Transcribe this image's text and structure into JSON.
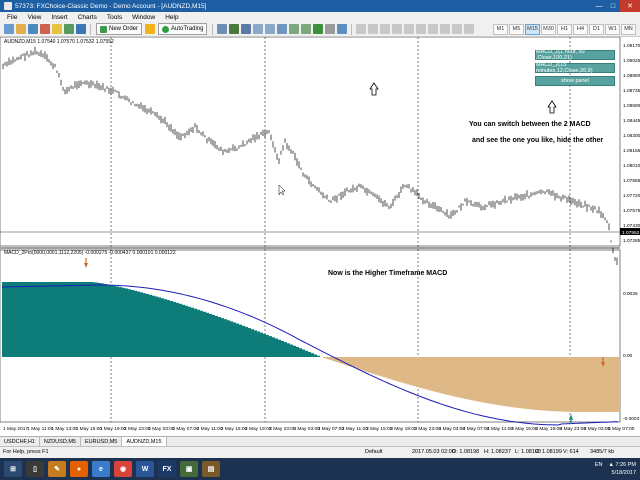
{
  "window": {
    "title": "57373: FXChoice-Classic Demo - Demo Account - [AUDNZD,M15]"
  },
  "menu": [
    "File",
    "View",
    "Insert",
    "Charts",
    "Tools",
    "Window",
    "Help"
  ],
  "toolbar": {
    "new_order": "New Order",
    "autotrading": "AutoTrading",
    "timeframes": [
      "M1",
      "M5",
      "M15",
      "M30",
      "H1",
      "H4",
      "D1",
      "W1",
      "MN"
    ],
    "active_timeframe": "M15"
  },
  "chart": {
    "header": "AUDNZD,M15  1.07540 1.07570 1.07532 1.07552",
    "price_scale": [
      "1.09170",
      "1.09025",
      "1.08880",
      "1.08735",
      "1.08590",
      "1.08445",
      "1.08300",
      "1.08155",
      "1.08010",
      "1.07865",
      "1.07720",
      "1.07575",
      "1.07430",
      "1.07285"
    ],
    "current_price": "1.07552",
    "price_line": "1.07552"
  },
  "macd": {
    "header": "MACD_2Pro(0000,0001,1112,2205) -0.000275 -0.000437 0.000101 0.000122",
    "scale": [
      "0.0026",
      "0.00",
      "-0.0003"
    ]
  },
  "side_panel": {
    "btn1": "MACD_1(1 hour, 50 ,Close,100,21)",
    "btn2": "MACD_2(15 minutes,12,Close,26,9)",
    "btn3": "show panel"
  },
  "annotations": {
    "line1": "You can switch between the 2 MACD",
    "line2": "and see the one you like, hide the other",
    "line3": "Now is the Higher Timeframe MACD"
  },
  "time_axis": [
    "1 May 2017",
    "1 May 11:00",
    "1 May 13:00",
    "1 May 15:00",
    "1 May 19:00",
    "2 May 23:00",
    "2 May 03:00",
    "2 May 07:00",
    "2 May 11:00",
    "2 May 15:00",
    "2 May 19:00",
    "2 May 23:00",
    "3 May 03:00",
    "3 May 07:00",
    "3 May 11:00",
    "3 May 15:00",
    "3 May 19:00",
    "3 May 23:00",
    "4 May 03:00",
    "4 May 07:00",
    "4 May 11:00",
    "4 May 15:00",
    "4 May 19:00",
    "4 May 23:00",
    "5 May 03:00",
    "5 May 07:00"
  ],
  "sheet_tabs": [
    "USDCHF,H1",
    "NZDUSD,M5",
    "EURUSD,M5",
    "AUDNZD,M15"
  ],
  "active_sheet": "AUDNZD,M15",
  "status": {
    "help": "For Help, press F1",
    "profile": "Default",
    "datetime": "2017.05.03 02:00",
    "open": "O: 1.08198",
    "high": "H: 1.08237",
    "low": "L: 1.08190",
    "close": "C: 1.08199",
    "volume": "V: 614",
    "traffic": "3485/7 kb"
  },
  "tray": {
    "lang": "EN",
    "time": "7:26 PM",
    "date": "5/18/2017"
  },
  "colors": {
    "bull_hist": "#0e7d7a",
    "bear_hist": "#deb887",
    "signal": "#1c1cb8",
    "arrow_down": "#d2691e",
    "arrow_up": "#1c8a8a"
  }
}
